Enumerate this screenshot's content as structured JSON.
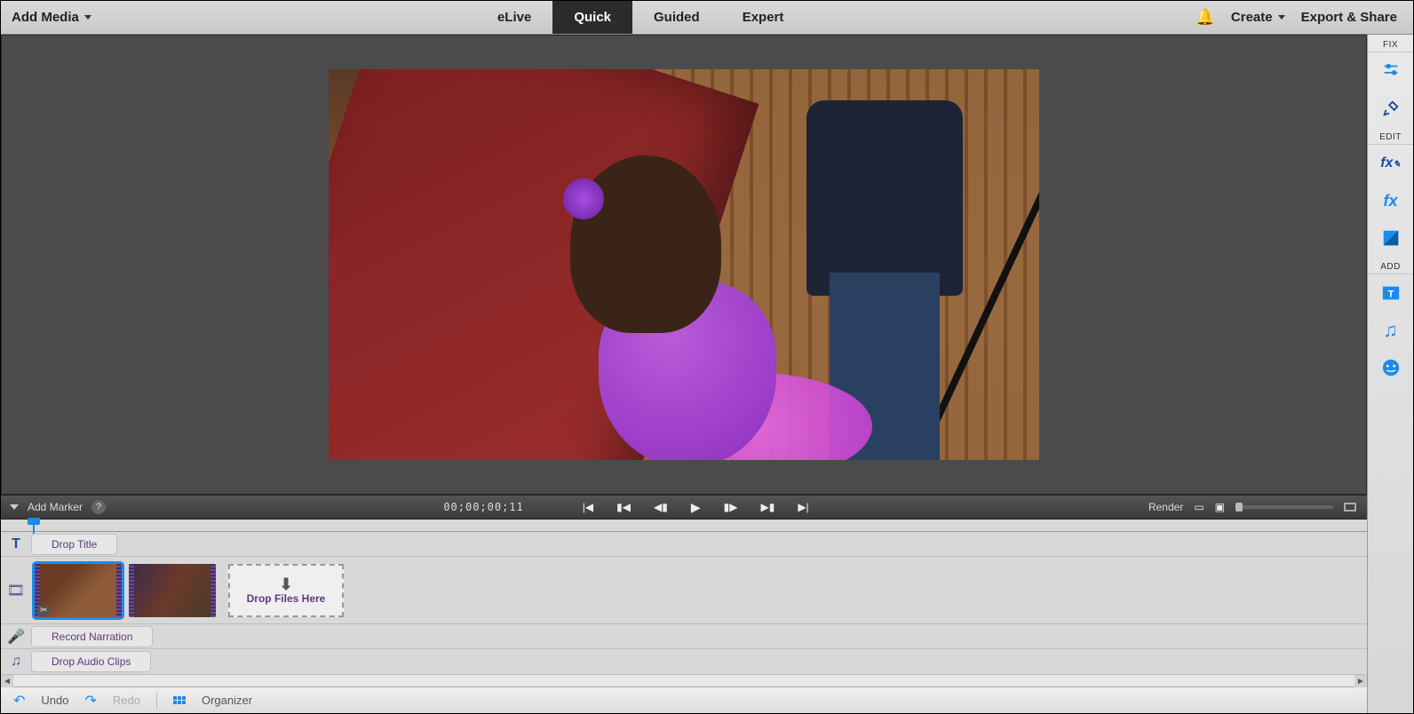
{
  "menubar": {
    "add_media": "Add Media",
    "modes": {
      "elive": "eLive",
      "quick": "Quick",
      "guided": "Guided",
      "expert": "Expert"
    },
    "create": "Create",
    "export": "Export & Share"
  },
  "transport": {
    "add_marker": "Add Marker",
    "timecode": "00;00;00;11",
    "render": "Render"
  },
  "timeline": {
    "drop_title": "Drop Title",
    "drop_files": "Drop Files Here",
    "record_narration": "Record Narration",
    "drop_audio": "Drop Audio Clips"
  },
  "bottombar": {
    "undo": "Undo",
    "redo": "Redo",
    "organizer": "Organizer"
  },
  "rightpanel": {
    "fix": "FIX",
    "edit": "EDIT",
    "add": "ADD"
  }
}
